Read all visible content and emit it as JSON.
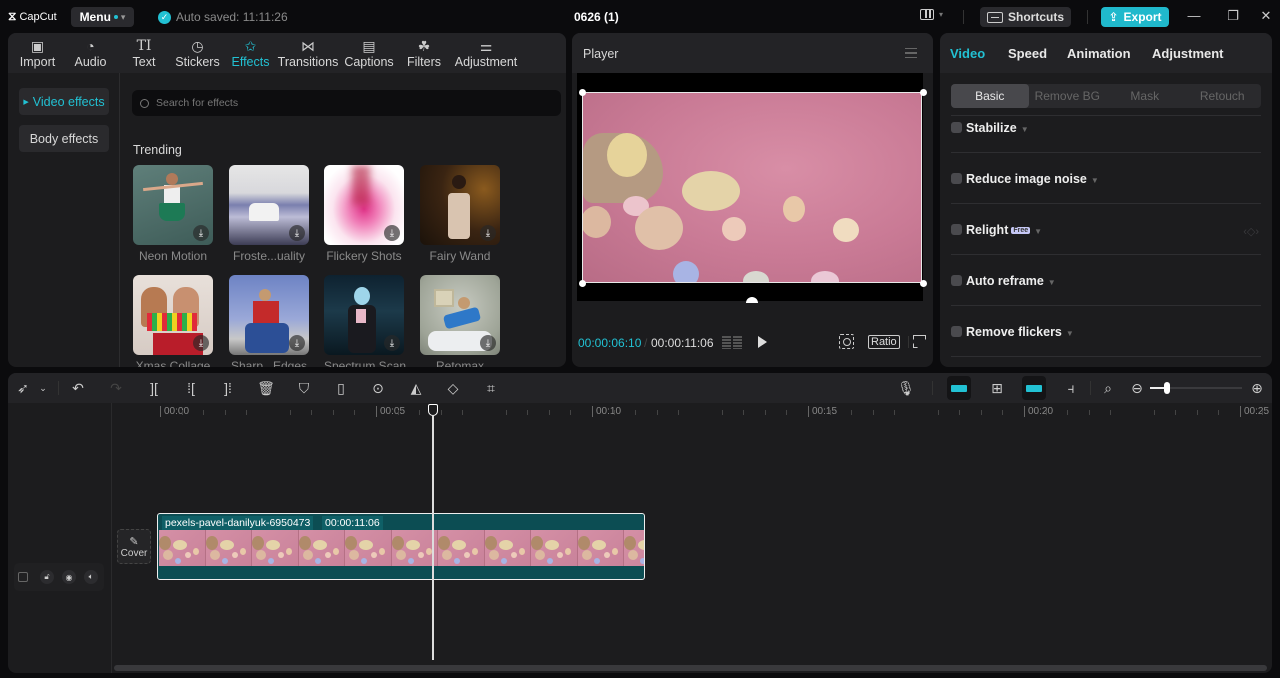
{
  "titlebar": {
    "logo_text": "CapCut",
    "menu_label": "Menu",
    "autosave_text": "Auto saved: 11:11:26",
    "project_title": "0626 (1)",
    "shortcuts_label": "Shortcuts",
    "export_label": "Export",
    "window_controls": [
      "minimize",
      "restore",
      "close"
    ]
  },
  "media": {
    "tabs": [
      {
        "label": "Import",
        "icon": "import-icon"
      },
      {
        "label": "Audio",
        "icon": "audio-icon"
      },
      {
        "label": "Text",
        "icon": "text-icon"
      },
      {
        "label": "Stickers",
        "icon": "stickers-icon"
      },
      {
        "label": "Effects",
        "icon": "effects-icon",
        "active": true
      },
      {
        "label": "Transitions",
        "icon": "transitions-icon"
      },
      {
        "label": "Captions",
        "icon": "captions-icon"
      },
      {
        "label": "Filters",
        "icon": "filters-icon"
      },
      {
        "label": "Adjustment",
        "icon": "adjustment-icon"
      }
    ],
    "sidebar": [
      {
        "label": "Video effects",
        "active": true
      },
      {
        "label": "Body effects"
      }
    ],
    "search_placeholder": "Search for effects",
    "section_title": "Trending",
    "effects": [
      {
        "label": "Neon Motion"
      },
      {
        "label": "Froste...uality"
      },
      {
        "label": "Flickery Shots"
      },
      {
        "label": "Fairy Wand"
      },
      {
        "label": "Xmas Collage"
      },
      {
        "label": "Sharp...Edges"
      },
      {
        "label": "Spectrum Scan"
      },
      {
        "label": "Retomax"
      }
    ]
  },
  "player": {
    "title": "Player",
    "current_time": "00:00:06:10",
    "total_time": "00:00:11:06",
    "ratio_label": "Ratio"
  },
  "properties": {
    "tabs": [
      {
        "label": "Video",
        "active": true
      },
      {
        "label": "Speed"
      },
      {
        "label": "Animation"
      },
      {
        "label": "Adjustment"
      }
    ],
    "subtabs": [
      {
        "label": "Basic",
        "active": true
      },
      {
        "label": "Remove BG"
      },
      {
        "label": "Mask"
      },
      {
        "label": "Retouch"
      }
    ],
    "options": [
      {
        "label": "Stabilize",
        "checked": false
      },
      {
        "label": "Reduce image noise",
        "checked": false
      },
      {
        "label": "Relight",
        "badge": "Free",
        "checked": false
      },
      {
        "label": "Auto reframe",
        "checked": false
      },
      {
        "label": "Remove flickers",
        "checked": false
      }
    ]
  },
  "timeline": {
    "ruler_labels": [
      "00:00",
      "00:05",
      "00:10",
      "00:15",
      "00:20",
      "00:25"
    ],
    "cover_label": "Cover",
    "clip": {
      "name": "pexels-pavel-danilyuk-6950473",
      "duration": "00:00:11:06"
    },
    "playhead_time": "00:00:06:10",
    "zoom_level": 0.2
  },
  "colors": {
    "accent": "#22c1d3",
    "clip_bg": "#0c4d53",
    "panel_bg": "#1c1c1e"
  }
}
